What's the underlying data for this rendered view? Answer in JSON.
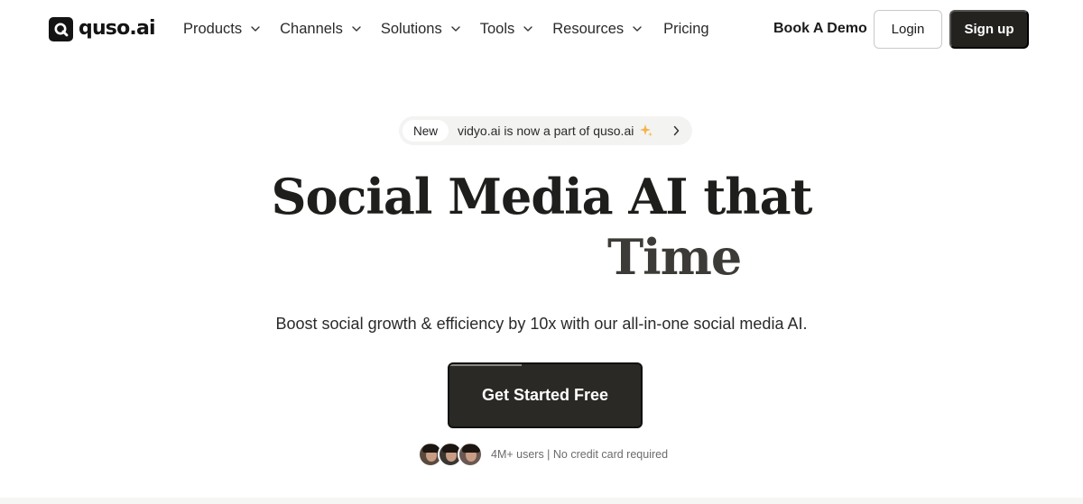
{
  "brand": {
    "name": "quso.ai"
  },
  "nav": {
    "items": [
      {
        "label": "Products",
        "has_dropdown": true
      },
      {
        "label": "Channels",
        "has_dropdown": true
      },
      {
        "label": "Solutions",
        "has_dropdown": true
      },
      {
        "label": "Tools",
        "has_dropdown": true
      },
      {
        "label": "Resources",
        "has_dropdown": true
      },
      {
        "label": "Pricing",
        "has_dropdown": false
      }
    ],
    "book_demo": "Book A Demo",
    "login": "Login",
    "signup": "Sign up"
  },
  "announcement": {
    "badge": "New",
    "text": "vidyo.ai is now a part of quso.ai",
    "icons": [
      "sparkle-icon",
      "chevron-right-icon"
    ]
  },
  "hero": {
    "title": "Social Media AI that",
    "rotating_word": "Time",
    "subtitle": "Boost social growth & efficiency by 10x with our all-in-one social media AI.",
    "cta": "Get Started Free",
    "social_proof": "4M+ users | No credit card required"
  },
  "colors": {
    "primary_dark": "#23221f",
    "announcement_bg": "#f3f3f1",
    "sparkle": "#f5b24a"
  }
}
